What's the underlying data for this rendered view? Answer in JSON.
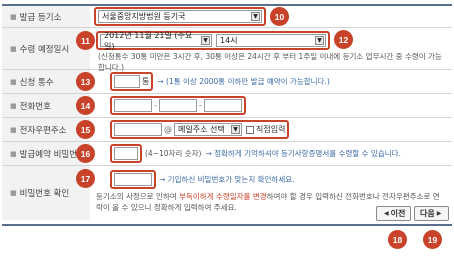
{
  "rows": {
    "office": {
      "label": "발급 등기소",
      "value": "서울중앙지방법원 등기국",
      "badge": "10"
    },
    "schedule": {
      "label": "수령 예정일시",
      "date_value": "2012년 11월 21일 (수요일)",
      "date_badge": "11",
      "time_value": "14시",
      "time_badge": "12",
      "note": "(신청통수 30통 미만은 3시간 후, 30통 이상은 24시간 후 부터 1주일 이내에 등기소 업무시간 중 수령이 가능합니다.)"
    },
    "count": {
      "label": "신청 통수",
      "unit": "통",
      "note": "→ (1통 이상 2000통 이하만 발급 예약이 가능합니다.)",
      "badge": "13"
    },
    "phone": {
      "label": "전화번호",
      "sep1": "-",
      "sep2": "-",
      "badge": "14"
    },
    "email": {
      "label": "전자우편주소",
      "at": "@",
      "domain_select": "메일주소 선택",
      "direct_input": "직접입력",
      "badge": "15"
    },
    "password": {
      "label": "발급예약 비밀번호",
      "hint": "(4~10자리 숫자)",
      "note": "→ 정확하게 기억하셔야 등기사항증명서를 수령할 수 있습니다.",
      "badge": "16"
    },
    "confirm": {
      "label": "비밀번호 확인",
      "note": "→ 기입하신 비밀번호가 맞는지 확인하세요.",
      "badge": "17",
      "desc_a": "등기소의 사정으로 인하여 ",
      "desc_b": "부득이하게 수령일자를 변경",
      "desc_c": "하여야 할 경우 입력하신 전화번호나 전자우편주소로 연락이 올 수 있으니 정확하게 입력하여 주세요."
    }
  },
  "buttons": {
    "prev": {
      "label": "이전",
      "badge": "18"
    },
    "next": {
      "label": "다음",
      "badge": "19"
    }
  },
  "colors": {
    "accent_red": "#c9422a",
    "header_line": "#5a6f8e",
    "label_bg": "#f2f2f2",
    "link_blue": "#3a6aa5"
  }
}
